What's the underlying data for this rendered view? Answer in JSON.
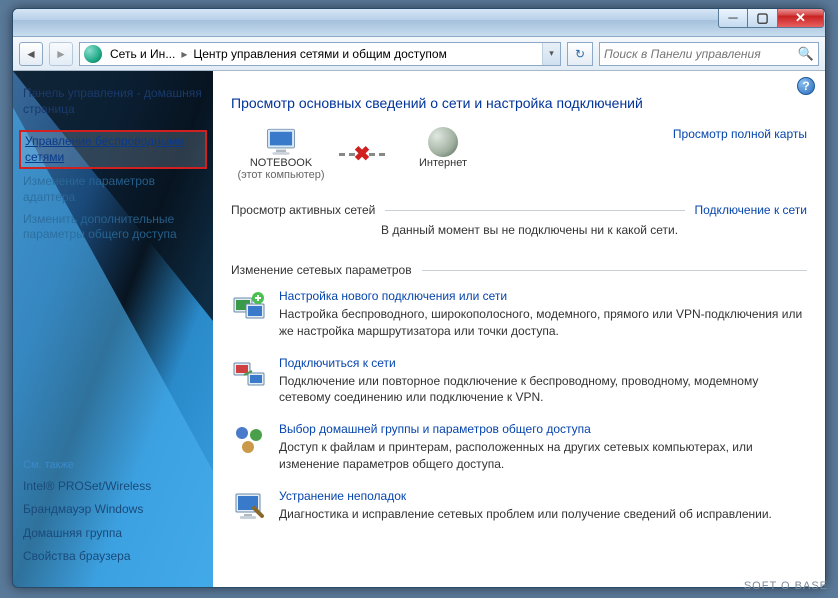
{
  "address": {
    "seg1": "Сеть и Ин...",
    "seg2": "Центр управления сетями и общим доступом"
  },
  "search": {
    "placeholder": "Поиск в Панели управления"
  },
  "sidebar": {
    "home": "Панель управления - домашняя страница",
    "items": [
      "Управление беспроводными сетями",
      "Изменение параметров адаптера",
      "Изменить дополнительные параметры общего доступа"
    ],
    "seealso_hdr": "См. также",
    "seealso": [
      "Intel® PROSet/Wireless",
      "Брандмауэр Windows",
      "Домашняя группа",
      "Свойства браузера"
    ]
  },
  "main": {
    "title": "Просмотр основных сведений о сети и настройка подключений",
    "fullmap": "Просмотр полной карты",
    "node1": "NOTEBOOK",
    "node1_sub": "(этот компьютер)",
    "node2": "Интернет",
    "active_hdr": "Просмотр активных сетей",
    "connect_link": "Подключение к сети",
    "active_note": "В данный момент вы не подключены ни к какой сети.",
    "change_hdr": "Изменение сетевых параметров",
    "options": [
      {
        "title": "Настройка нового подключения или сети",
        "desc": "Настройка беспроводного, широкополосного, модемного, прямого или VPN-подключения или же настройка маршрутизатора или точки доступа."
      },
      {
        "title": "Подключиться к сети",
        "desc": "Подключение или повторное подключение к беспроводному, проводному, модемному сетевому соединению или подключение к VPN."
      },
      {
        "title": "Выбор домашней группы и параметров общего доступа",
        "desc": "Доступ к файлам и принтерам, расположенных на других сетевых компьютерах, или изменение параметров общего доступа."
      },
      {
        "title": "Устранение неполадок",
        "desc": "Диагностика и исправление сетевых проблем или получение сведений об исправлении."
      }
    ]
  },
  "watermark": "SOFT O BASE"
}
